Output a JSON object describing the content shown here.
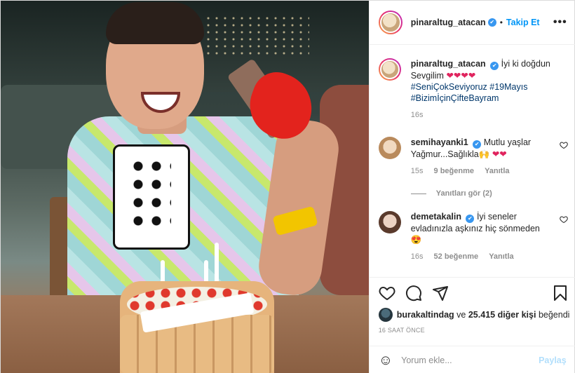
{
  "header": {
    "username": "pinaraltug_atacan",
    "verified_mark": "✔",
    "separator": "•",
    "follow_label": "Takip Et",
    "more_label": "•••"
  },
  "caption": {
    "username": "pinaraltug_atacan",
    "text_line1": "İyi ki doğdun",
    "text_line2": "Sevgilim",
    "hearts": "❤❤❤❤",
    "hashtags_line1": "#SeniÇokSeviyoruz #19Mayıs",
    "hashtags_line2": "#BizimİçinÇifteBayram",
    "time": "16s"
  },
  "comments": [
    {
      "username": "semihayanki1",
      "text_line1": "Mutlu yaşlar",
      "text_line2": "Yağmur...Sağlıkla",
      "emoji": "🙌",
      "hearts": "❤❤",
      "time": "15s",
      "likes": "9 beğenme",
      "reply": "Yanıtla"
    },
    {
      "username": "demetakalin",
      "text_line1": "İyi seneler",
      "text_line2": "evladınızla aşkınız hiç sönmeden",
      "emoji": "😍",
      "time": "16s",
      "likes": "52 beğenme",
      "reply": "Yanıtla"
    }
  ],
  "view_replies": "Yanıtları gör (2)",
  "likes": {
    "user": "burakaltindag",
    "connector": "ve",
    "count_text": "25.415 diğer kişi",
    "suffix": "beğendi"
  },
  "post_time": "16 SAAT ÖNCE",
  "comment_box": {
    "emoji_icon": "☺",
    "placeholder": "Yorum ekle...",
    "post_label": "Paylaş"
  },
  "icons": {
    "like": "heart-outline",
    "comment": "speech-bubble",
    "share": "paper-plane",
    "save": "bookmark"
  },
  "colors": {
    "link": "#0095f6",
    "hashtag": "#00376b",
    "verified": "#3897f0",
    "heart": "#e0245e",
    "post_disabled": "#b2dffc"
  }
}
